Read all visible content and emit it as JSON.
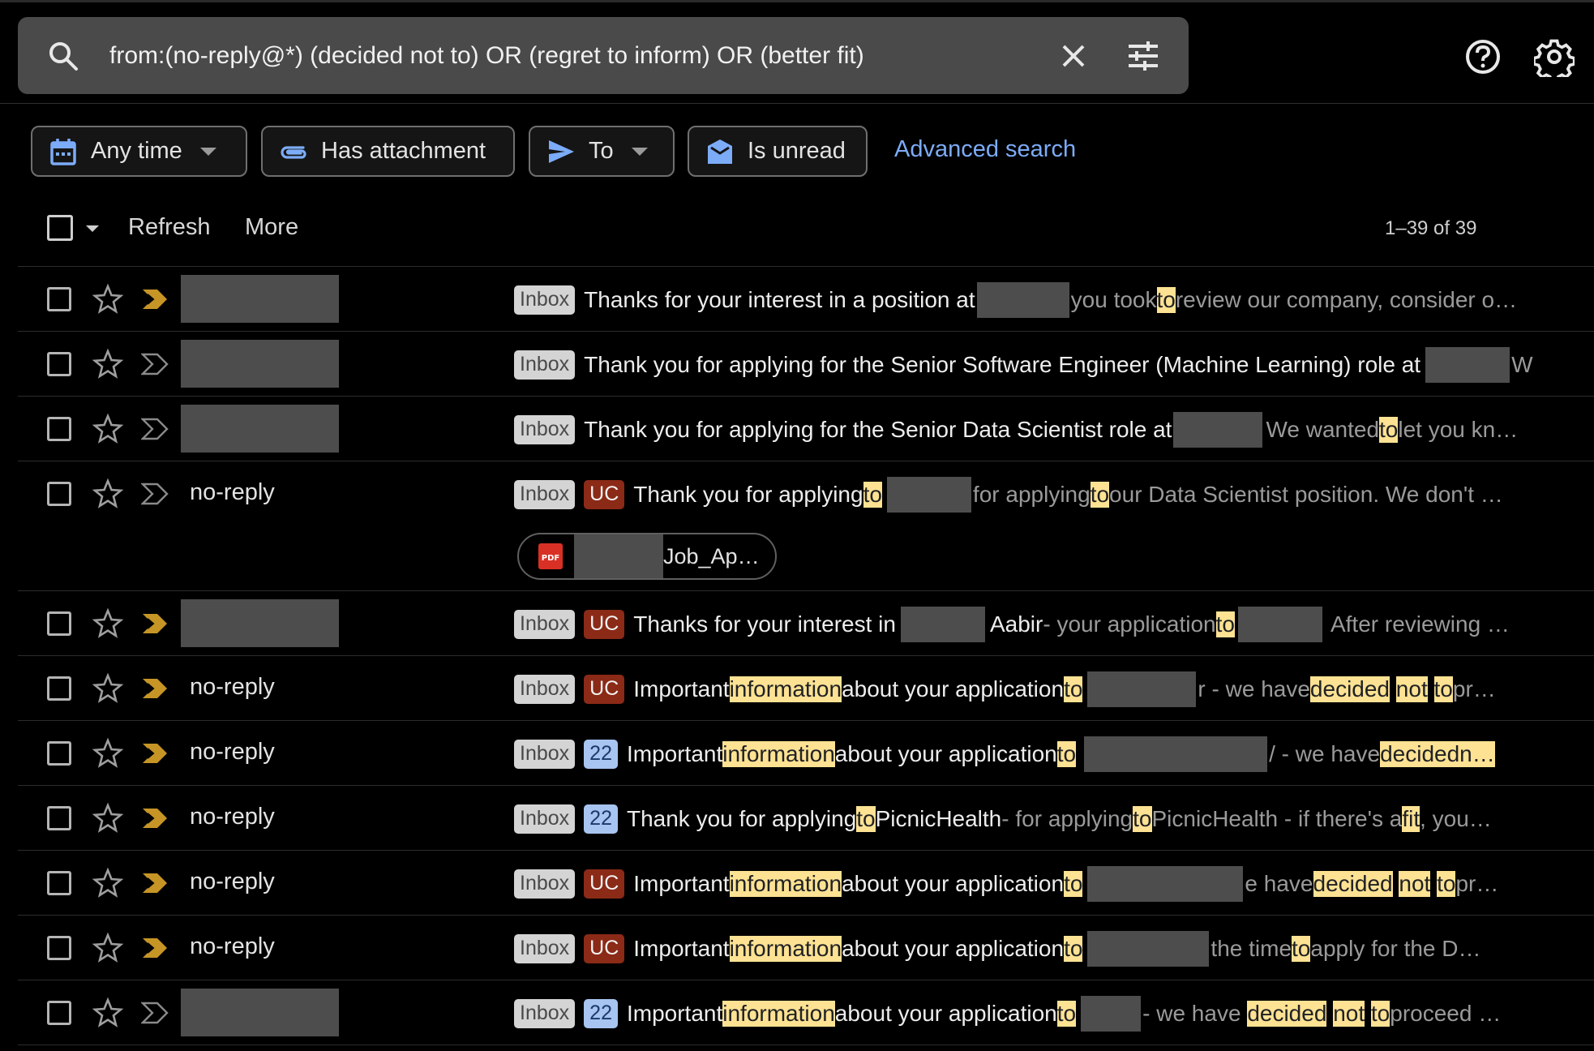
{
  "search": {
    "query": "from:(no-reply@*) (decided not to) OR (regret to inform) OR (better fit)"
  },
  "filters": {
    "any_time": "Any time",
    "has_attachment": "Has attachment",
    "to": "To",
    "is_unread": "Is unread",
    "advanced_search": "Advanced search"
  },
  "toolbar": {
    "refresh": "Refresh",
    "more": "More",
    "count": "1–39 of 39"
  },
  "colors": {
    "highlight": "#fde293",
    "uc_label": "#8b2a17",
    "label_22": "#a8c4f0",
    "important_filled": "#c69526",
    "link": "#7cacf8"
  },
  "labels": {
    "inbox": "Inbox",
    "uc": "UC",
    "n22": "22"
  },
  "attachment": {
    "name": "Job_Ap…",
    "type": "PDF"
  },
  "emails": [
    {
      "sender": "",
      "important": true,
      "s1": "Thanks for your interest in a position at",
      "s2": "",
      "s3": "",
      "s4": "",
      "n1": "you took ",
      "n1h": "to",
      "n2": " review our company, consider o…",
      "n2h": "",
      "n3": ""
    },
    {
      "sender": "",
      "important": false,
      "s1": "Thank you for applying for the Senior Software Engineer (Machine Learning) role at",
      "n1": " W"
    },
    {
      "sender": "",
      "important": false,
      "s1": "Thank you for applying for the Senior Data Scientist role at",
      "n1": "We wanted ",
      "n1h": "to",
      "n2": " let you kn…"
    },
    {
      "sender": "no-reply",
      "important": false,
      "s1": "Thank you for applying ",
      "s1h": "to",
      "n1": " for applying ",
      "n1h": "to",
      "n2": " our Data Scientist position. We don't …"
    },
    {
      "sender": "",
      "important": true,
      "s1": "Thanks for your interest in ",
      "s2": "Aabir",
      "n1": " - your application ",
      "n1h": "to",
      "n2": "After reviewing …"
    },
    {
      "sender": "no-reply",
      "important": true,
      "s1": "Important ",
      "s1h": "information",
      "s2": " about your application ",
      "s2h": "to",
      "n1": "r - we have ",
      "n1h": "decided",
      "n1h2": "not",
      "n1h3": "to",
      "n2": " pr…"
    },
    {
      "sender": "no-reply",
      "important": true,
      "s1": "Important ",
      "s1h": "information",
      "s2": " about your application ",
      "s2h": "to",
      "n1": "/ - we have ",
      "n1h": "decided",
      "n1h2": " n…"
    },
    {
      "sender": "no-reply",
      "important": true,
      "s1": "Thank you for applying ",
      "s1h": "to",
      "s2": " PicnicHealth",
      "n1": " - for applying ",
      "n1h": "to",
      "n2": " PicnicHealth - if there's a ",
      "n2h": "fit",
      "n3": ", you…"
    },
    {
      "sender": "no-reply",
      "important": true,
      "s1": "Important ",
      "s1h": "information",
      "s2": " about your application ",
      "s2h": "to",
      "n1": "e have ",
      "n1h": "decided",
      "n1h2": "not",
      "n1h3": "to",
      "n2": " pr…"
    },
    {
      "sender": "no-reply",
      "important": true,
      "s1": "Important ",
      "s1h": "information",
      "s2": " about your application ",
      "s2h": "to",
      "n1": " the time ",
      "n1h": "to",
      "n2": " apply for the D…"
    },
    {
      "sender": "",
      "important": false,
      "s1": "Important ",
      "s1h": "information",
      "s2": " about your application ",
      "s2h": "to",
      "n1": " - we have ",
      "n1h": "decided",
      "n1h2": "not",
      "n1h3": "to",
      "n2": " proceed …"
    }
  ]
}
